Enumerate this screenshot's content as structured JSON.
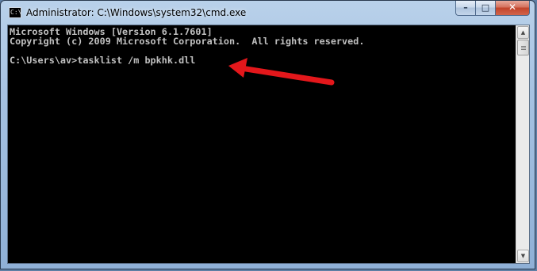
{
  "window": {
    "title": "Administrator: C:\\Windows\\system32\\cmd.exe",
    "icon": "cmd-icon",
    "icon_text": "C:\\"
  },
  "controls": {
    "minimize": "–",
    "maximize": "□",
    "close": "✕"
  },
  "console": {
    "lines": [
      "Microsoft Windows [Version 6.1.7601]",
      "Copyright (c) 2009 Microsoft Corporation.  All rights reserved.",
      "",
      "C:\\Users\\av>tasklist /m bpkhk.dll"
    ],
    "text_color": "#c0c0c0",
    "background": "#000000"
  },
  "scrollbar": {
    "up": "▲",
    "down": "▼"
  },
  "annotation": {
    "arrow_color": "#e3171b",
    "icon": "red-arrow-icon"
  }
}
